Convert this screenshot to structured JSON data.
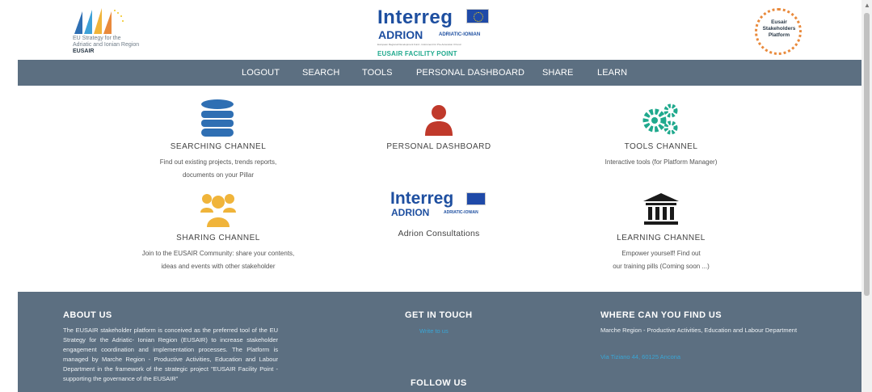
{
  "header": {
    "eusair_logo": {
      "line1": "EU Strategy for the",
      "line2": "Adriatic and Ionian Region",
      "line3": "EUSAIR"
    },
    "interreg_logo": {
      "brand": "Interreg",
      "program": "ADRION",
      "region": "ADRIATIC-IONIAN",
      "fine_print": "European Regional Development Fund - Instrument for Pre-Accession II Fund",
      "facility": "EUSAIR FACILITY POINT"
    },
    "esp_logo": {
      "line1": "Eusair",
      "line2": "Stakeholders",
      "line3": "Platform"
    }
  },
  "nav": {
    "items": [
      {
        "label": "LOGOUT"
      },
      {
        "label": "SEARCH"
      },
      {
        "label": "TOOLS"
      },
      {
        "label": "PERSONAL DASHBOARD"
      },
      {
        "label": "SHARE"
      },
      {
        "label": "LEARN"
      }
    ]
  },
  "channels": [
    {
      "title": "SEARCHING CHANNEL",
      "desc1": "Find out existing projects, trends reports,",
      "desc2": "documents on your Pillar",
      "icon": "database-icon"
    },
    {
      "title": "PERSONAL DASHBOARD",
      "desc1": "",
      "desc2": "",
      "icon": "user-icon"
    },
    {
      "title": "TOOLS CHANNEL",
      "desc1": "Interactive tools (for Platform Manager)",
      "desc2": "",
      "icon": "gears-icon"
    },
    {
      "title": "SHARING CHANNEL",
      "desc1": "Join to the EUSAIR Community: share your contents,",
      "desc2": "ideas and events with other stakeholder",
      "icon": "users-icon"
    },
    {
      "title": "Adrion Consultations",
      "desc1": "",
      "desc2": "",
      "icon": "interreg-logo",
      "logo_brand": "Interreg",
      "logo_program": "ADRION",
      "logo_region": "ADRIATIC-IONIAN"
    },
    {
      "title": "LEARNING CHANNEL",
      "desc1": "Empower yourself! Find out",
      "desc2": "our training pills (Coming soon ...)",
      "icon": "institution-icon"
    }
  ],
  "footer": {
    "about": {
      "heading": "ABOUT US",
      "text": "The EUSAIR stakeholder platform is conceived as the preferred tool of the EU Strategy for the Adriatic- Ionian Region (EUSAIR) to increase stakeholder engagement coordination and implementation processes. The Platform is managed by Marche Region - Productive Activities, Education and Labour Department in the framework of the strategic project \"EUSAIR Facility Point - supporting the governance of the EUSAIR\""
    },
    "contact": {
      "heading": "GET IN TOUCH",
      "link": "Write to us"
    },
    "follow": {
      "heading": "FOLLOW US"
    },
    "location": {
      "heading": "WHERE CAN YOU FIND US",
      "text": "Marche Region - Productive Activities, Education and Labour Department",
      "address": "Via Tiziano 44, 60125 Ancona"
    }
  },
  "colors": {
    "nav_bg": "#5c6f81",
    "database": "#2f6fb3",
    "user": "#c0392b",
    "gears": "#1fa98d",
    "users": "#f0b43a",
    "institution": "#1a1a1a",
    "link": "#39a6d6"
  }
}
